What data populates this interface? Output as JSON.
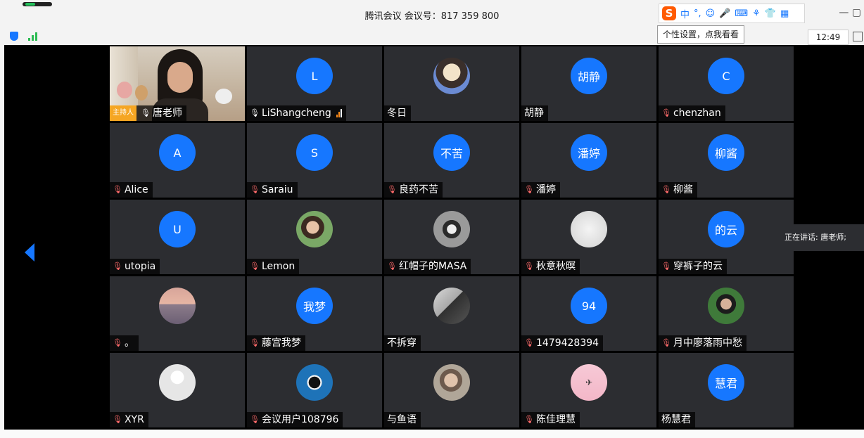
{
  "window": {
    "title": "腾讯会议 会议号：817 359 800",
    "time": "12:49",
    "tooltip": "个性设置，点我看看",
    "win_controls": "—  ▢"
  },
  "ime": {
    "logo": "S",
    "mode": "中",
    "items": [
      "°,",
      "☺",
      "🎤",
      "⌨",
      "⚘",
      "👕",
      "▦"
    ]
  },
  "speaking": "正在讲话: 唐老师;",
  "colors": {
    "accent": "#1677ff",
    "muted_mic": "#ff6b6b",
    "host_badge": "#f5a623"
  },
  "participants": [
    {
      "name": "唐老师",
      "host_label": "主持人",
      "video": true,
      "mic": "on"
    },
    {
      "name": "LiShangcheng",
      "avatar": "L",
      "mic": "on",
      "signal": true
    },
    {
      "name": "冬日",
      "avatar_image": "anime-girl-avatar",
      "mic": "none"
    },
    {
      "name": "胡静",
      "avatar": "胡静",
      "mic": "none"
    },
    {
      "name": "chenzhan",
      "avatar": "C",
      "mic": "muted"
    },
    {
      "name": "Alice",
      "avatar": "A",
      "mic": "muted"
    },
    {
      "name": "Saraiu",
      "avatar": "S",
      "mic": "muted"
    },
    {
      "name": "良药不苦",
      "avatar": "不苦",
      "mic": "muted"
    },
    {
      "name": "潘婷",
      "avatar": "潘婷",
      "mic": "muted"
    },
    {
      "name": "柳酱",
      "avatar": "柳酱",
      "mic": "muted"
    },
    {
      "name": "utopia",
      "avatar": "U",
      "mic": "muted"
    },
    {
      "name": "Lemon",
      "avatar_image": "woman-photo-avatar",
      "mic": "muted"
    },
    {
      "name": "红帽子的MASA",
      "avatar_image": "raccoon-avatar",
      "mic": "muted"
    },
    {
      "name": "秋意秋暝",
      "avatar_image": "sketch-avatar",
      "mic": "muted"
    },
    {
      "name": "穿裤子的云",
      "avatar": "的云",
      "mic": "muted"
    },
    {
      "name": "。",
      "avatar_image": "sunset-avatar",
      "mic": "muted"
    },
    {
      "name": "藤宫我梦",
      "avatar": "我梦",
      "mic": "muted"
    },
    {
      "name": "不拆穿",
      "avatar_image": "hooded-figure-avatar",
      "mic": "none"
    },
    {
      "name": "1479428394",
      "avatar": "94",
      "mic": "muted"
    },
    {
      "name": "月中廖落雨中愁",
      "avatar_image": "green-portrait-avatar",
      "mic": "muted"
    },
    {
      "name": "XYR",
      "avatar_image": "default-person-avatar",
      "mic": "muted"
    },
    {
      "name": "会议用户108796",
      "avatar_image": "blue-cartoon-avatar",
      "mic": "muted"
    },
    {
      "name": "与鱼语",
      "avatar_image": "child-photo-avatar",
      "mic": "none"
    },
    {
      "name": "陈佳理慧",
      "avatar_image": "pink-sky-plane-avatar",
      "mic": "muted"
    },
    {
      "name": "杨慧君",
      "avatar": "慧君",
      "mic": "none"
    }
  ]
}
